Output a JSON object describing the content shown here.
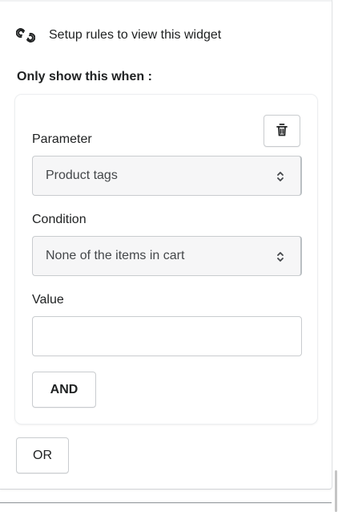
{
  "header": {
    "setup_icon": "link-rules-icon",
    "setup_text": "Setup rules to view this widget"
  },
  "rules": {
    "heading": "Only show this when :",
    "delete_icon": "trash-icon",
    "parameter": {
      "label": "Parameter",
      "value": "Product tags"
    },
    "condition": {
      "label": "Condition",
      "value": "None of the items in cart"
    },
    "value_field": {
      "label": "Value",
      "value": ""
    },
    "and_label": "AND"
  },
  "or_label": "OR",
  "colors": {
    "text": "#202223",
    "border": "#c9cccf",
    "select_bg": "#f6f6f7"
  }
}
